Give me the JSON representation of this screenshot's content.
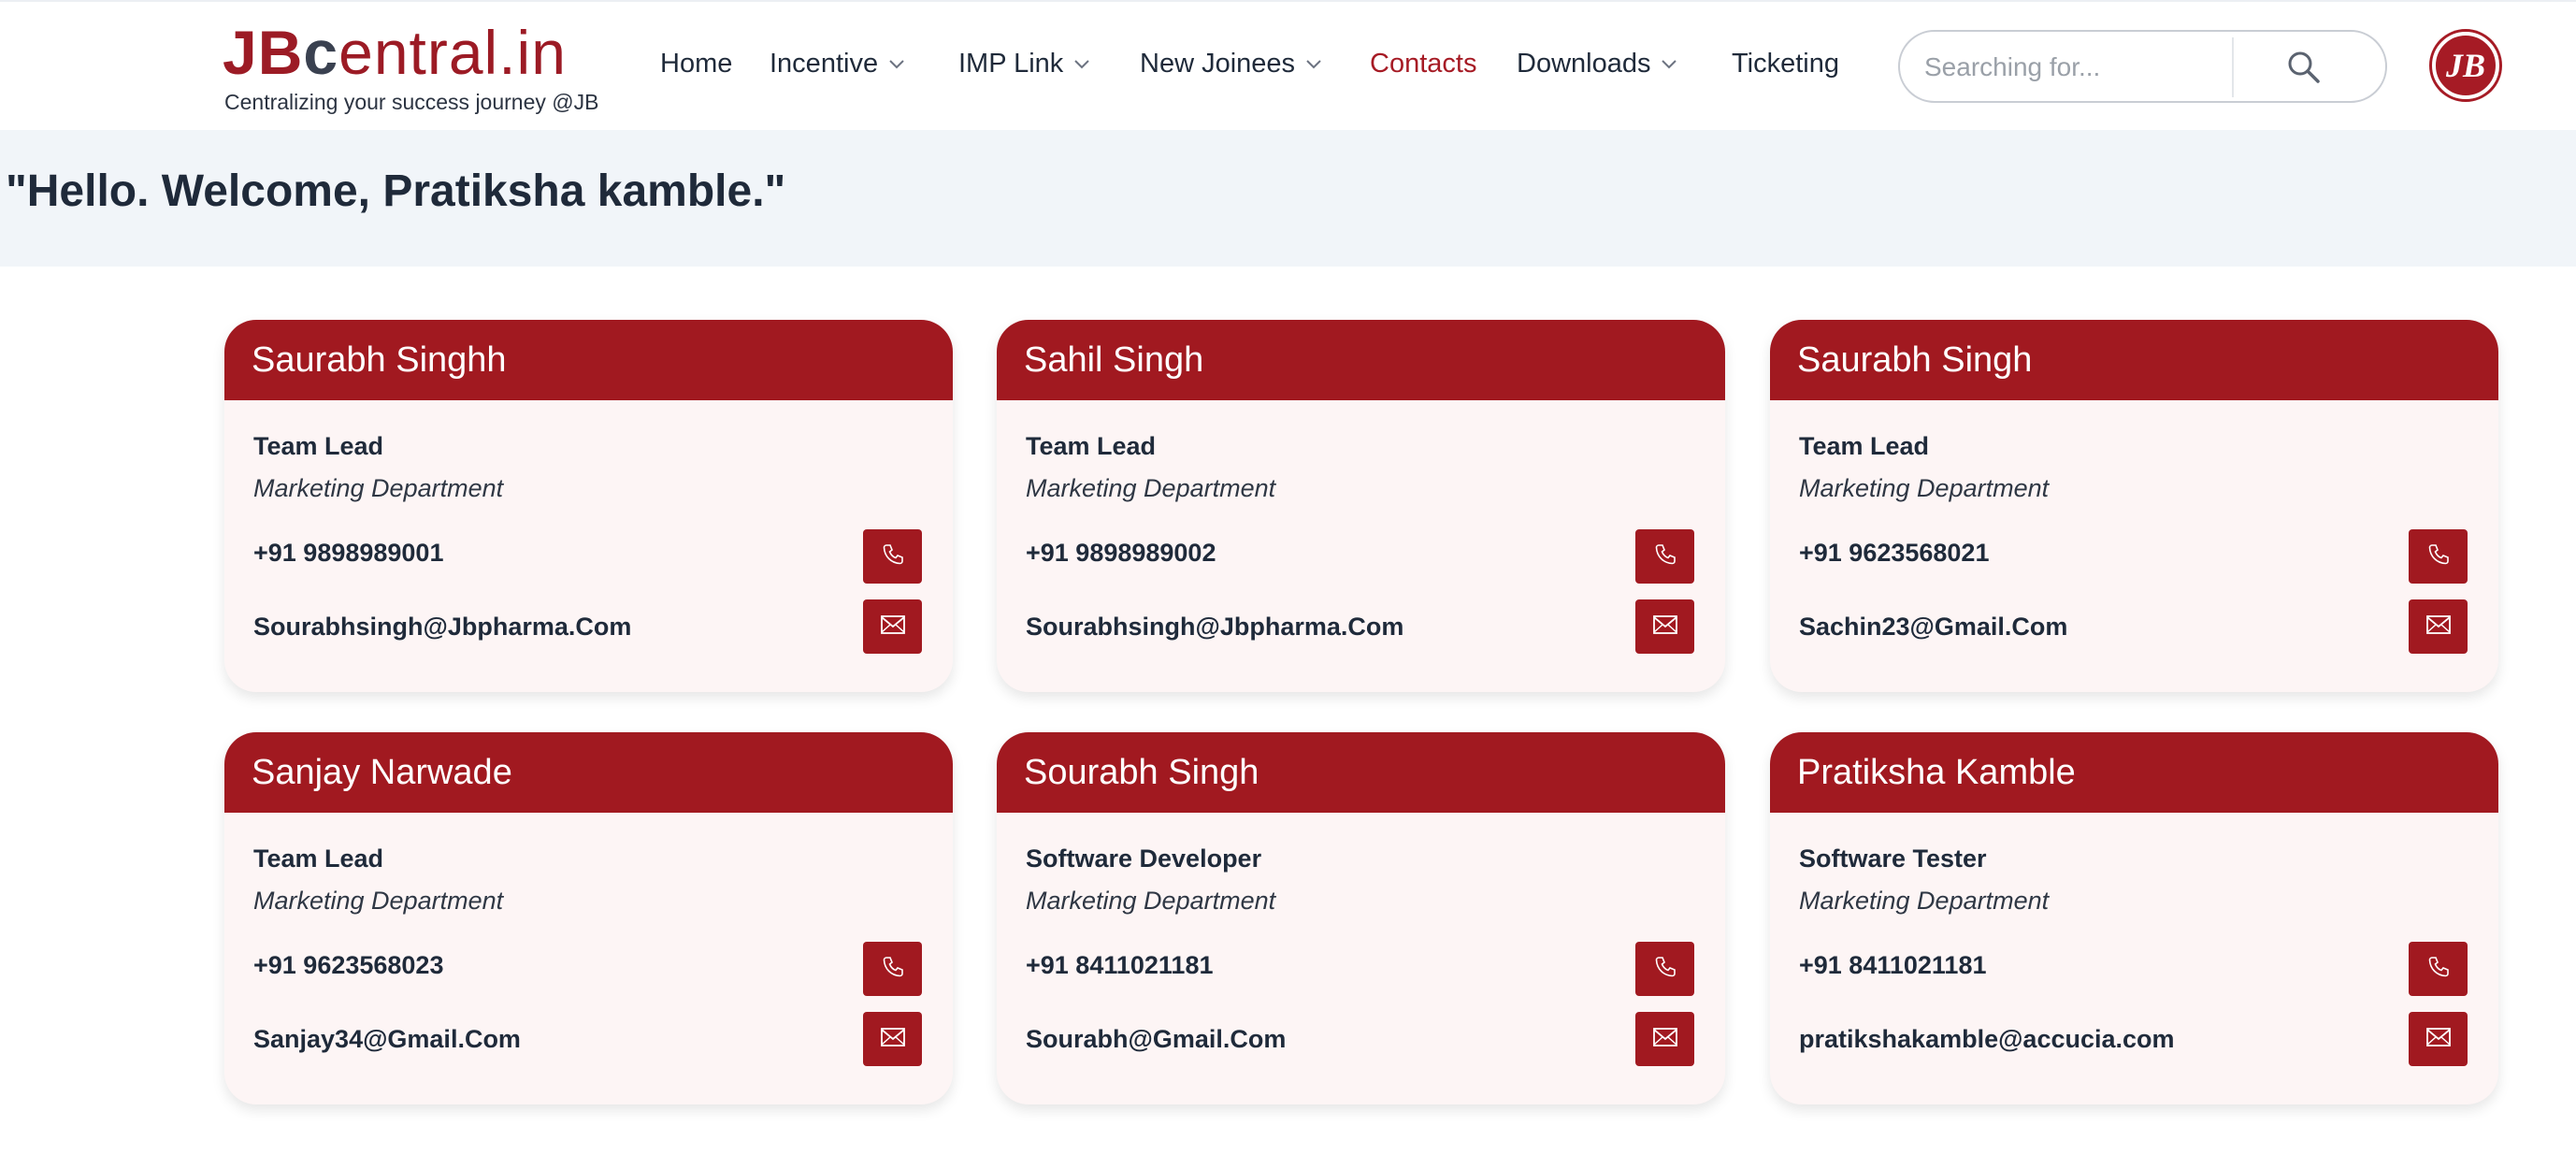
{
  "header": {
    "logo": {
      "brand_jb": "JB",
      "brand_central_c": "c",
      "brand_central_e": "e",
      "brand_central_rest": "ntral.in",
      "tagline": "Centralizing your success journey @JB"
    },
    "nav": [
      {
        "label": "Home",
        "dropdown": false,
        "active": false
      },
      {
        "label": "Incentive",
        "dropdown": true,
        "active": false
      },
      {
        "label": "IMP Link",
        "dropdown": true,
        "active": false
      },
      {
        "label": "New Joinees",
        "dropdown": true,
        "active": false
      },
      {
        "label": "Contacts",
        "dropdown": false,
        "active": true
      },
      {
        "label": "Downloads",
        "dropdown": true,
        "active": false
      },
      {
        "label": "Ticketing",
        "dropdown": false,
        "active": false
      }
    ],
    "search": {
      "placeholder": "Searching for...",
      "value": ""
    },
    "avatar_text": "JB"
  },
  "welcome": {
    "text": "\"Hello. Welcome, Pratiksha kamble.\""
  },
  "contacts": [
    {
      "name": "Saurabh Singhh",
      "role": "Team Lead",
      "department": "Marketing Department",
      "phone": "+91 9898989001",
      "email": "Sourabhsingh@Jbpharma.Com"
    },
    {
      "name": "Sahil Singh",
      "role": "Team Lead",
      "department": "Marketing Department",
      "phone": "+91 9898989002",
      "email": "Sourabhsingh@Jbpharma.Com"
    },
    {
      "name": "Saurabh Singh",
      "role": "Team Lead",
      "department": "Marketing Department",
      "phone": "+91 9623568021",
      "email": "Sachin23@Gmail.Com"
    },
    {
      "name": "Sanjay Narwade",
      "role": "Team Lead",
      "department": "Marketing Department",
      "phone": "+91 9623568023",
      "email": "Sanjay34@Gmail.Com"
    },
    {
      "name": "Sourabh Singh",
      "role": "Software Developer",
      "department": "Marketing Department",
      "phone": "+91 8411021181",
      "email": "Sourabh@Gmail.Com"
    },
    {
      "name": "Pratiksha Kamble",
      "role": "Software Tester",
      "department": "Marketing Department",
      "phone": "+91 8411021181",
      "email": "pratikshakamble@accucia.com"
    }
  ],
  "colors": {
    "brand": "#a11920",
    "text": "#1f2a3a",
    "band": "#f1f5f9",
    "card_bg": "#fdf5f5"
  },
  "icons": {
    "search": "search-icon",
    "call": "phone-icon",
    "mail": "mail-icon",
    "dropdown": "chevron-down-icon"
  }
}
